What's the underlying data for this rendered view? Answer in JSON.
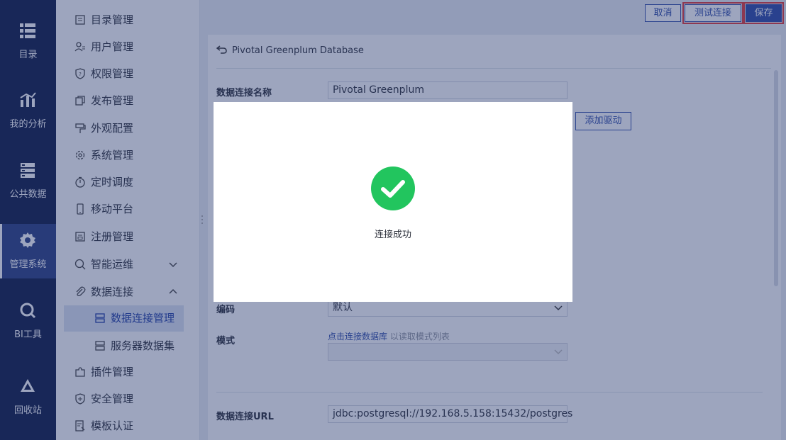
{
  "leftnav": {
    "items": [
      {
        "label": "目录",
        "icon": "list-icon"
      },
      {
        "label": "我的分析",
        "icon": "chart-icon"
      },
      {
        "label": "公共数据",
        "icon": "database-icon"
      },
      {
        "label": "管理系统",
        "icon": "gear-icon"
      },
      {
        "label": "BI工具",
        "icon": "wrench-icon"
      },
      {
        "label": "回收站",
        "icon": "recycle-icon"
      }
    ],
    "active_index": 3
  },
  "subnav": {
    "items": [
      {
        "label": "目录管理"
      },
      {
        "label": "用户管理"
      },
      {
        "label": "权限管理"
      },
      {
        "label": "发布管理"
      },
      {
        "label": "外观配置"
      },
      {
        "label": "系统管理"
      },
      {
        "label": "定时调度"
      },
      {
        "label": "移动平台"
      },
      {
        "label": "注册管理"
      },
      {
        "label": "智能运维"
      },
      {
        "label": "数据连接"
      },
      {
        "label": "数据连接管理"
      },
      {
        "label": "服务器数据集"
      },
      {
        "label": "插件管理"
      },
      {
        "label": "安全管理"
      },
      {
        "label": "模板认证"
      }
    ]
  },
  "toolbar": {
    "cancel_label": "取消",
    "test_label": "测试连接",
    "save_label": "保存"
  },
  "panel": {
    "title": "Pivotal Greenplum Database",
    "fields": {
      "name_label": "数据连接名称",
      "name_value": "Pivotal Greenplum",
      "add_driver_label": "添加驱动",
      "encoding_label": "编码",
      "encoding_value": "默认",
      "schema_label": "模式",
      "schema_hint_link": "点击连接数据库",
      "schema_hint_text": "以读取模式列表",
      "url_label": "数据连接URL",
      "url_value": "jdbc:postgresql://192.168.5.158:15432/postgres"
    }
  },
  "modal": {
    "message": "连接成功"
  },
  "colors": {
    "nav_bg": "#0e1a45",
    "accent": "#2c4aa8",
    "success": "#22c55e",
    "highlight": "#e23a3a"
  }
}
